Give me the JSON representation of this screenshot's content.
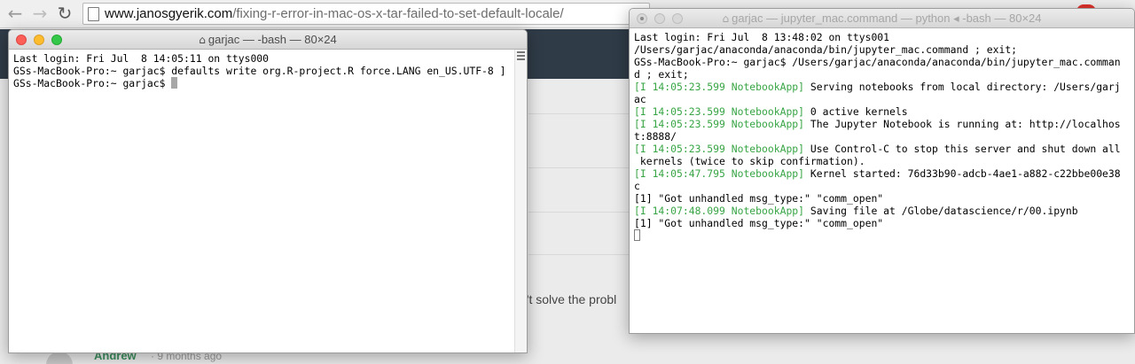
{
  "browser": {
    "url_host": "www.janosgyerik.com",
    "url_path": "/fixing-r-error-in-mac-os-x-tar-failed-to-set-default-locale/",
    "back_glyph": "←",
    "forward_glyph": "→",
    "reload_glyph": "↻",
    "extension_color": "#e0322c"
  },
  "page": {
    "comment_fragment": "n't solve the probl",
    "comment_author": "Andrew",
    "comment_time": "· 9 months ago",
    "header_color": "#2f3b47",
    "author_color": "#3c8e5e"
  },
  "terminal_left": {
    "title": "garjac — -bash — 80×24",
    "lines": [
      "Last login: Fri Jul  8 14:05:11 on ttys000",
      "GSs-MacBook-Pro:~ garjac$ defaults write org.R-project.R force.LANG en_US.UTF-8 ]",
      "GSs-MacBook-Pro:~ garjac$ "
    ]
  },
  "terminal_right": {
    "title": "garjac — jupyter_mac.command — python ◂ -bash — 80×24",
    "lines": {
      "l1": "Last login: Fri Jul  8 13:48:02 on ttys001",
      "l2": "/Users/garjac/anaconda/anaconda/bin/jupyter_mac.command ; exit;",
      "l3": "GSs-MacBook-Pro:~ garjac$ /Users/garjac/anaconda/anaconda/bin/jupyter_mac.comman",
      "l4": "d ; exit;",
      "l5_tag": "[I 14:05:23.599 NotebookApp]",
      "l5_msg": " Serving notebooks from local directory: /Users/garj",
      "l6": "ac",
      "l7_tag": "[I 14:05:23.599 NotebookApp]",
      "l7_msg": " 0 active kernels",
      "l8_tag": "[I 14:05:23.599 NotebookApp]",
      "l8_msg": " The Jupyter Notebook is running at: http://localhos",
      "l9": "t:8888/",
      "l10_tag": "[I 14:05:23.599 NotebookApp]",
      "l10_msg": " Use Control-C to stop this server and shut down all",
      "l11": " kernels (twice to skip confirmation).",
      "l12_tag": "[I 14:05:47.795 NotebookApp]",
      "l12_msg": " Kernel started: 76d33b90-adcb-4ae1-a882-c22bbe00e38",
      "l13": "c",
      "l14": "[1] \"Got unhandled msg_type:\" \"comm_open\"",
      "l15_tag": "[I 14:07:48.099 NotebookApp]",
      "l15_msg": " Saving file at /Globe/datascience/r/00.ipynb",
      "l16": "[1] \"Got unhandled msg_type:\" \"comm_open\""
    }
  },
  "colors": {
    "log_tag": "#38a545",
    "close": "#fc5f57",
    "minimize": "#fdbc2e",
    "zoom": "#34c749"
  },
  "glyphs": {
    "house": "⌂"
  }
}
